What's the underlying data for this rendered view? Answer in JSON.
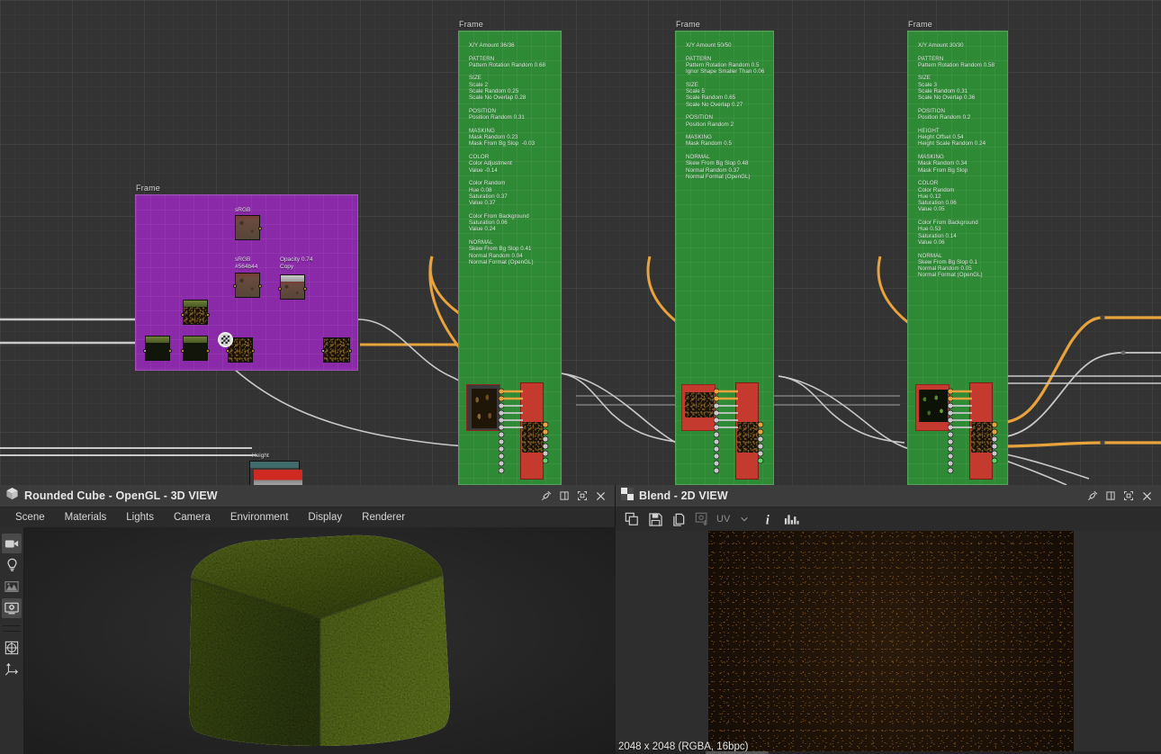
{
  "graph": {
    "frames": [
      {
        "label": "Frame",
        "color": "#8a2aa8",
        "nodes": [
          {
            "label": "sRGB"
          },
          {
            "label": "sRGB\n#564b44"
          },
          {
            "label": "Opacity 0.74\nCopy"
          }
        ]
      },
      {
        "label": "Frame",
        "color": "#2f8a36",
        "text": "X/Y Amount 36/36\n\nPATTERN\nPattern Rotation Random 0.68\n\nSIZE\nScale 2\nScale Random 0.25\nScale No Overlap 0.28\n\nPOSITION\nPosition Random 0.31\n\nMASKING\nMask Random 0.23\nMask From Bg Slop  -0.03\n\nCOLOR\nColor Adjustment\nValue -0.14\n\nColor Random\nHue 0.08\nSaturation 0.37\nValue 0.37\n\nColor From Background\nSaturation 0.06\nValue 0.24\n\nNORMAL\nSkew From Bg Slop 0.41\nNormal Random 0.04\nNormal Format (OpenGL)"
      },
      {
        "label": "Frame",
        "color": "#2f8a36",
        "text": "X/Y Amount 50/50\n\nPATTERN\nPattern Rotation Random 0.5\nIgnor Shape Smaller Than 0.06\n\nSIZE\nScale 5\nScale Random 0.65\nScale No Overlap 0.27\n\nPOSITION\nPosition Random 2\n\nMASKING\nMask Random 0.5\n\nNORMAL\nSkew From Bg Slop 0.48\nNormal Random 0.37\nNormal Format (OpenGL)"
      },
      {
        "label": "Frame",
        "color": "#2f8a36",
        "text": "X/Y Amount 30/30\n\nPATTERN\nPattern Rotation Random 0.58\n\nSIZE\nScale 3\nScale Random 0.31\nScale No Overlap 0.36\n\nPOSITION\nPosition Random 0.2\n\nHEIGHT\nHeight Offset 0.54\nHeight Scale Random 0.24\n\nMASKING\nMask Random 0.34\nMask From Bg Slop\n\nCOLOR\nColor Random\nHue 0.12\nSaturation 0.06\nValue 0.05\n\nColor From Background\nHue 0.53\nSaturation 0.14\nValue 0.06\n\nNORMAL\nSkew From Bg Slop 0.1\nNormal Random 0.05\nNormal Format (OpenGL)"
      }
    ],
    "height_node_label": "Height"
  },
  "panel3d": {
    "title": "Rounded Cube - OpenGL - 3D VIEW",
    "window_icon": "cube-icon",
    "window_buttons": [
      "pin-icon",
      "restore-icon",
      "maximize-icon",
      "close-icon"
    ],
    "menu": [
      "Scene",
      "Materials",
      "Lights",
      "Camera",
      "Environment",
      "Display",
      "Renderer"
    ],
    "sidebar": [
      {
        "name": "camera-icon",
        "selected": true
      },
      {
        "name": "light-icon",
        "selected": false
      },
      {
        "name": "environment-icon",
        "selected": false
      },
      {
        "name": "display-icon",
        "selected": true
      },
      {
        "name": "grid-icon",
        "selected": false
      },
      {
        "name": "axes-icon",
        "selected": false
      }
    ]
  },
  "panel2d": {
    "title": "Blend - 2D VIEW",
    "window_icon": "checker-icon",
    "window_buttons": [
      "pin-icon",
      "restore-icon",
      "maximize-icon",
      "close-icon"
    ],
    "toolbar": [
      {
        "name": "duplicate-icon",
        "label": ""
      },
      {
        "name": "save-icon",
        "label": ""
      },
      {
        "name": "copy-icon",
        "label": ""
      },
      {
        "name": "export-icon",
        "label": ""
      },
      {
        "name": "uv-dropdown",
        "label": "UV"
      },
      {
        "name": "info-icon",
        "label": ""
      },
      {
        "name": "histogram-icon",
        "label": ""
      }
    ],
    "status": "2048 x 2048 (RGBA, 16bpc)"
  },
  "colors": {
    "background": "#333333",
    "frame_green": "#2f8a36",
    "frame_purple": "#8a2aa8",
    "wire_orange": "#e8a33d",
    "wire_gray": "#c9c9c9",
    "panel_bg": "#2b2b2b",
    "titlebar": "#3c3c3c"
  }
}
